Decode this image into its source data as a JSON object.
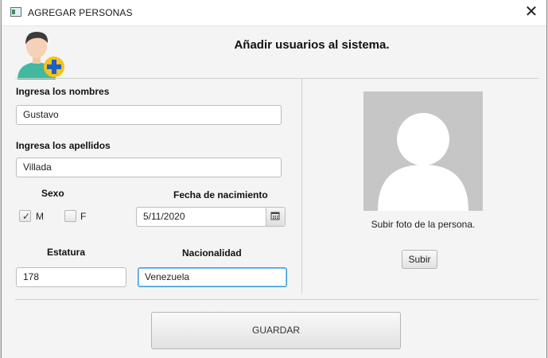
{
  "window": {
    "title": "AGREGAR PERSONAS",
    "close_symbol": "✕"
  },
  "header": {
    "title": "Añadir usuarios al sistema."
  },
  "form": {
    "nombres": {
      "label": "Ingresa los nombres",
      "value": "Gustavo"
    },
    "apellidos": {
      "label": "Ingresa los apellidos",
      "value": "Villada"
    },
    "sexo": {
      "label": "Sexo",
      "options": [
        {
          "label": "M",
          "checked": true
        },
        {
          "label": "F",
          "checked": false
        }
      ]
    },
    "fecha": {
      "label": "Fecha de nacimiento",
      "value": "5/11/2020",
      "icon": "calendar-icon"
    },
    "estatura": {
      "label": "Estatura",
      "value": "178"
    },
    "nacionalidad": {
      "label": "Nacionalidad",
      "value": "Venezuela"
    }
  },
  "photo": {
    "caption": "Subir foto de la persona.",
    "upload_label": "Subir",
    "icon": "person-placeholder-icon"
  },
  "actions": {
    "save_label": "GUARDAR"
  },
  "colors": {
    "focus_border": "#3a9bd8",
    "photo_bg": "#c6c6c6",
    "badge_yellow": "#f6c21b",
    "badge_blue": "#1f5fbf"
  }
}
